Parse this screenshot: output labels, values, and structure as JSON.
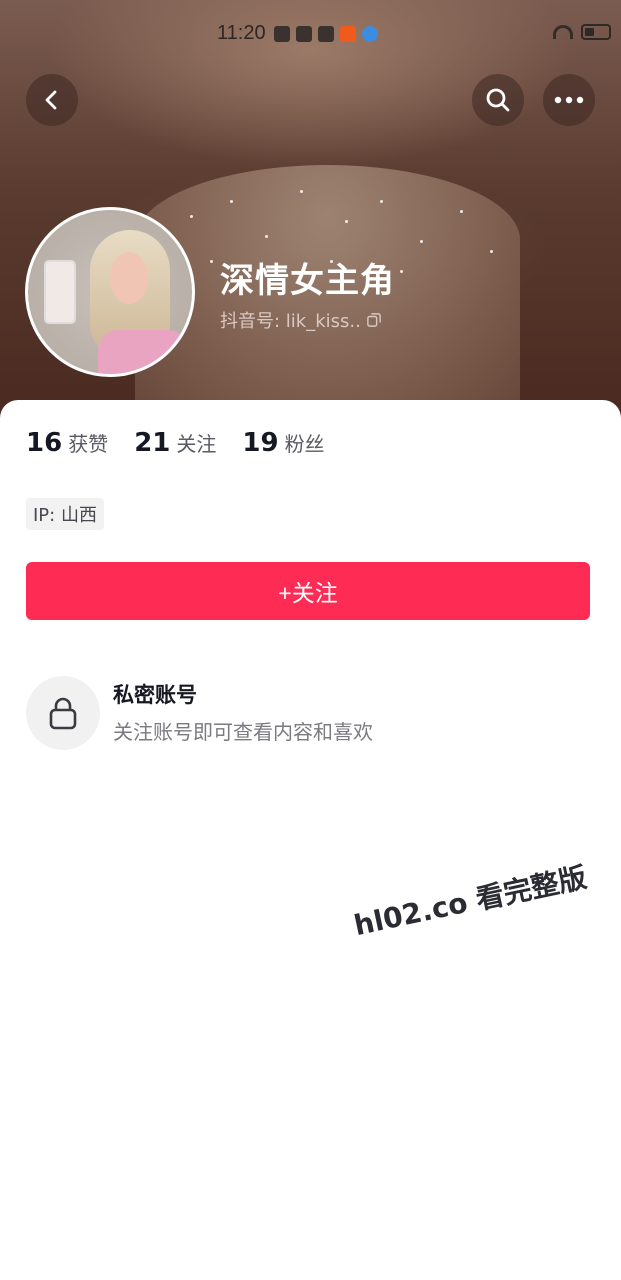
{
  "status_bar": {
    "time": "11:20"
  },
  "header": {
    "back_icon": "chevron-left-icon",
    "search_icon": "search-icon",
    "more_icon": "more-horizontal-icon"
  },
  "profile": {
    "name": "深情女主角",
    "douyin_id_label": "抖音号: lik_kiss..",
    "copy_icon": "copy-icon"
  },
  "stats": [
    {
      "value": "16",
      "label": "获赞"
    },
    {
      "value": "21",
      "label": "关注"
    },
    {
      "value": "19",
      "label": "粉丝"
    }
  ],
  "ip": {
    "label": "IP: 山西"
  },
  "follow_button": {
    "label": "+关注",
    "color": "#fe2c55"
  },
  "private_notice": {
    "icon": "lock-icon",
    "title": "私密账号",
    "description": "关注账号即可查看内容和喜欢"
  },
  "watermark": {
    "text": "hl02.co 看完整版"
  }
}
